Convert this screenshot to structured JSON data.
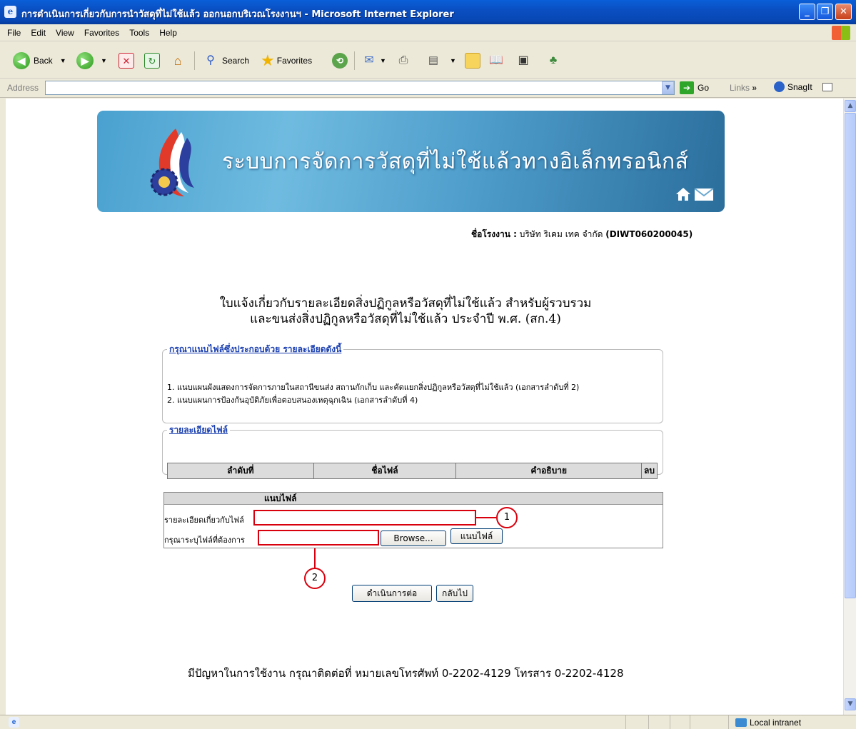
{
  "window": {
    "title": "การดำเนินการเกี่ยวกับการนำวัสดุที่ไม่ใช้แล้ว ออกนอกบริเวณโรงงานฯ - Microsoft Internet Explorer",
    "icon": "ie-icon"
  },
  "menu": [
    "File",
    "Edit",
    "View",
    "Favorites",
    "Tools",
    "Help"
  ],
  "toolbar": {
    "back": "Back",
    "search": "Search",
    "favorites": "Favorites"
  },
  "address": {
    "label": "Address",
    "value": "",
    "go": "Go",
    "links": "Links",
    "snagit": "SnagIt"
  },
  "banner": {
    "title": "ระบบการจัดการวัสดุที่ไม่ใช้แล้วทางอิเล็กทรอนิกส์"
  },
  "factory": {
    "label": "ชื่อโรงงาน :",
    "name": "บริษัท ริเคม เทค จำกัด",
    "code": "(DIWT060200045)"
  },
  "heading": {
    "line1": "ใบแจ้งเกี่ยวกับรายละเอียดสิ่งปฏิกูลหรือวัสดุที่ไม่ใช้แล้ว สำหรับผู้รวบรวม",
    "line2": "และขนส่งสิ่งปฏิกูลหรือวัสดุที่ไม่ใช้แล้ว ประจำปี พ.ศ. (สก.4)"
  },
  "instructions": {
    "legend": "กรุณาแนบไฟล์ซึ่งประกอบด้วย รายละเอียดดังนี้",
    "items": [
      "1. แนบแผนผังแสดงการจัดการภายในสถานีขนส่ง สถานกักเก็บ และคัดแยกสิ่งปฏิกูลหรือวัสดุที่ไม่ใช้แล้ว (เอกสารลำดับที่ 2)",
      "2. แนบแผนการป้องกันอุบัติภัยเพื่อตอบสนองเหตุฉุกเฉิน (เอกสารลำดับที่ 4)"
    ]
  },
  "file_details": {
    "legend": "รายละเอียดไฟล์",
    "columns": [
      "ลำดับที่",
      "ชื่อไฟล์",
      "คำอธิบาย",
      "ลบ"
    ]
  },
  "attach": {
    "header": "แนบไฟล์",
    "desc_label": "รายละเอียดเกี่ยวกับไฟล์",
    "desc_value": "",
    "file_label": "กรุณาระบุไฟล์ที่ต้องการ",
    "file_value": "",
    "browse": "Browse...",
    "attach_btn": "แนบไฟล์"
  },
  "callouts": [
    "1",
    "2"
  ],
  "buttons": {
    "proceed": "ดำเนินการต่อ",
    "back": "กลับไป"
  },
  "footer": "มีปัญหาในการใช้งาน กรุณาติดต่อที่ หมายเลขโทรศัพท์ 0-2202-4129 โทรสาร 0-2202-4128",
  "status": {
    "zone": "Local intranet"
  }
}
